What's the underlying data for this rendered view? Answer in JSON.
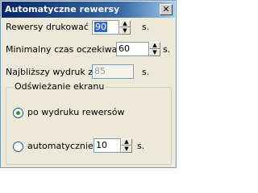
{
  "window": {
    "title": "Automatyczne rewersy",
    "close_glyph": "✕"
  },
  "fields": {
    "print_every": {
      "label": "Rewersy drukować co",
      "value": "90",
      "unit": "s."
    },
    "min_wait": {
      "label": "Minimalny czas oczekiwania:",
      "value": "60",
      "unit": "s."
    },
    "next_print": {
      "label": "Najbliższy wydruk za:",
      "value": "85",
      "unit": "s."
    }
  },
  "refresh_group": {
    "title": "Odświeżanie ekranu",
    "options": [
      {
        "label": "po wydruku rewersów",
        "selected": true
      },
      {
        "label": "automatycznie co",
        "value": "10",
        "unit": "s.",
        "selected": false
      }
    ]
  },
  "icons": {
    "spin_up": "▲",
    "spin_down": "▼"
  }
}
